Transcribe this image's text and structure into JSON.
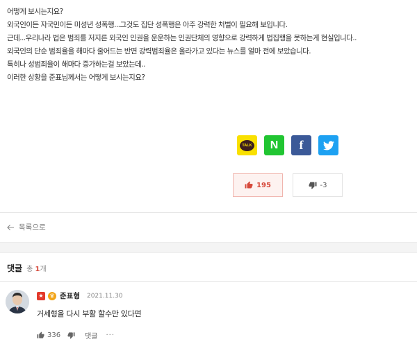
{
  "article": {
    "lines": [
      "어떻게 보시는지요?",
      "외국인이든 자국민이든 미성년 성폭행...그것도 집단 성폭행은 아주 강력한 처벌이 필요해 보입니다.",
      "근데...우리나라 법은 범죄를 저지른 외국인 인권을 운운하는 인권단체의 영향으로 강력하게 법집행을 못하는게 현실입니다..",
      "외국인의 단순 범죄율을 해마다 줄어드는 반면 강력범죄율은 올라가고 있다는 뉴스를 얼마 전에 보았습니다.",
      "특히나 성범죄율이 해마다 증가하는걸 보았는데..",
      "이러한 상황을 준표님께서는 어떻게 보시는지요?"
    ]
  },
  "share": {
    "kakao_label": "TALK",
    "naver_label": "N",
    "facebook_label": "f"
  },
  "votes": {
    "up_count": "195",
    "down_count": "-3"
  },
  "nav": {
    "back_label": "목록으로"
  },
  "comments": {
    "title": "댓글",
    "count_prefix": "총 ",
    "count_value": "1",
    "count_suffix": "개",
    "items": [
      {
        "author": "준표형",
        "date": "2021.11.30",
        "text": "거세형을 다시 부활 할수만 있다면",
        "likes": "336",
        "reply_label": "댓글",
        "more_label": "···"
      }
    ]
  },
  "colors": {
    "like_red": "#d6493b",
    "kakao": "#f9e000",
    "naver": "#21c532",
    "facebook": "#3b5998",
    "twitter": "#1da1f2"
  }
}
